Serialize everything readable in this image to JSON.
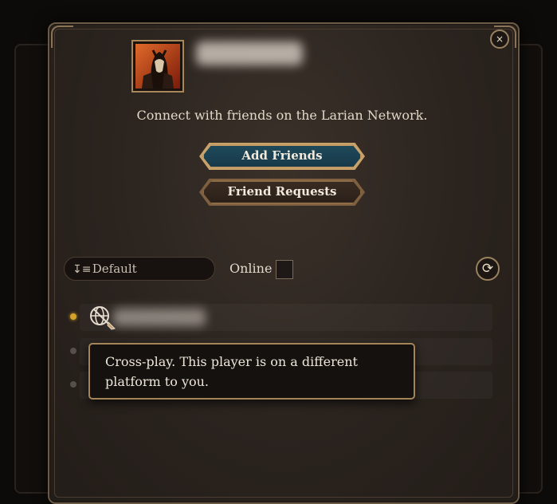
{
  "dialog": {
    "close_glyph": "×",
    "tagline": "Connect with friends on the Larian Network.",
    "add_friends_label": "Add Friends",
    "friend_requests_label": "Friend Requests"
  },
  "filters": {
    "sort_icon": "↧≡",
    "sort_value": "Default",
    "online_label": "Online",
    "online_checked": false,
    "refresh_glyph": "⟳"
  },
  "friends": [
    {
      "status": "online",
      "crossplay": true
    },
    {
      "status": "offline",
      "crossplay": false
    },
    {
      "status": "offline",
      "crossplay": false
    }
  ],
  "tooltip": {
    "text": "Cross-play. This player is on a different platform to you."
  },
  "colors": {
    "accent_gold": "#c29a63",
    "primary_button": "#1f4a5a",
    "online_dot": "#d4a12a"
  }
}
